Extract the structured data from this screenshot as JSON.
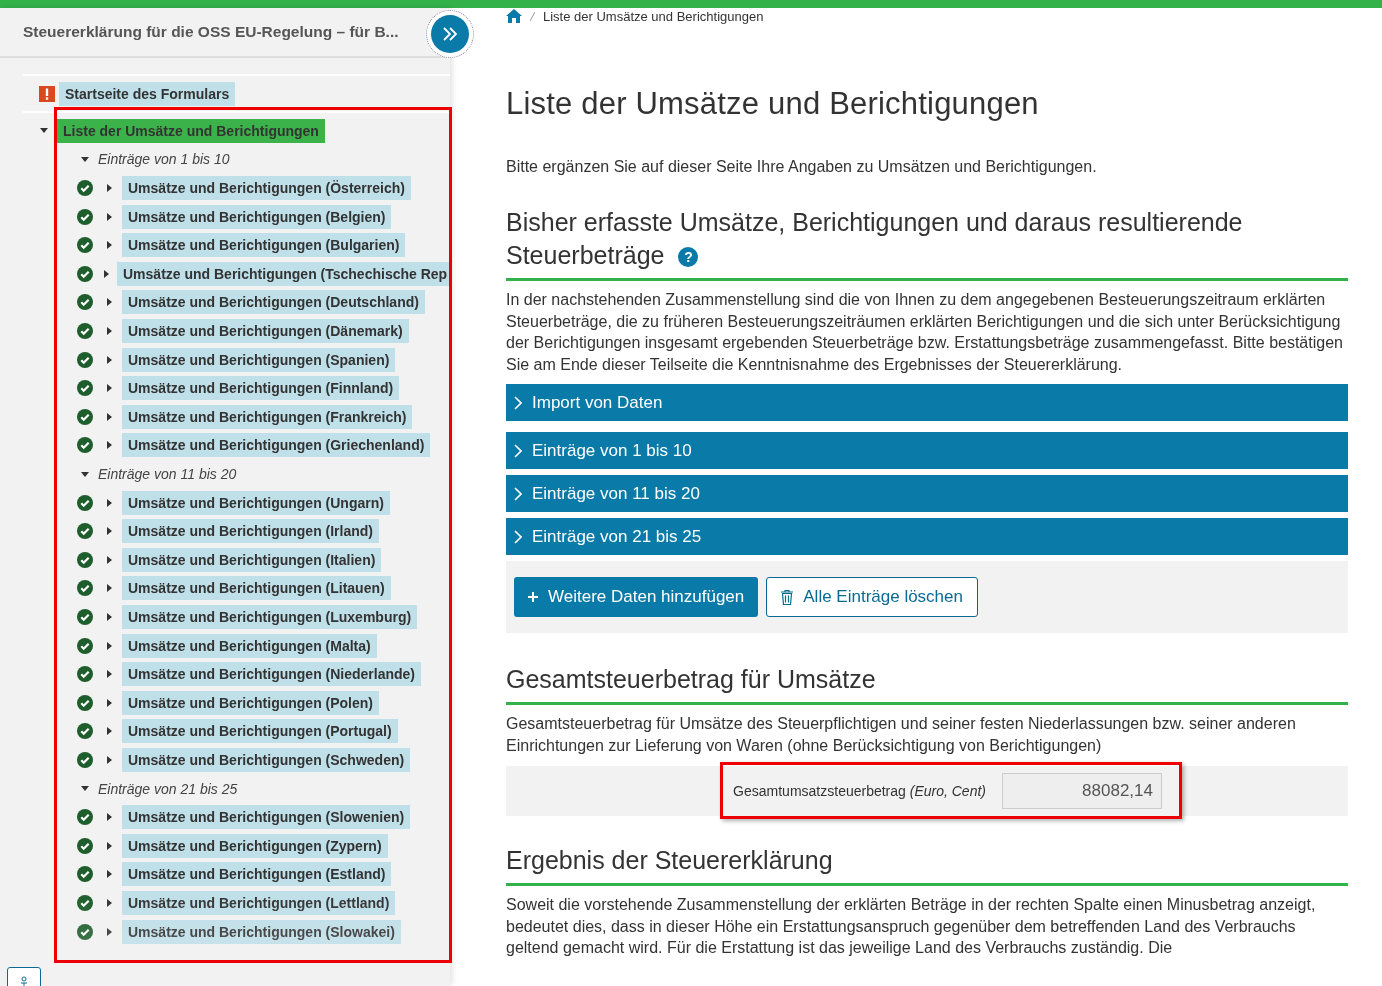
{
  "header": {
    "title": "Steuererklärung für die OSS EU-Regelung – für B..."
  },
  "breadcrumb": {
    "items": [
      "Liste der Umsätze und Berichtigungen"
    ]
  },
  "nav": [
    {
      "label": "Startseite des Formulars",
      "kind": "error",
      "selected": false
    },
    {
      "label": "Liste der Umsätze und Berichtigungen",
      "selected": true,
      "expanded": true,
      "children": [
        {
          "label": "Einträge von 1 bis 10",
          "expanded": true,
          "children": [
            {
              "label": "Umsätze und Berichtigungen (Österreich)",
              "kind": "done",
              "expanded": false
            },
            {
              "label": "Umsätze und Berichtigungen (Belgien)",
              "kind": "done",
              "expanded": false
            },
            {
              "label": "Umsätze und Berichtigungen (Bulgarien)",
              "kind": "done",
              "expanded": false
            },
            {
              "label": "Umsätze und Berichtigungen (Tschechische Rep",
              "kind": "done",
              "expanded": false
            },
            {
              "label": "Umsätze und Berichtigungen (Deutschland)",
              "kind": "done",
              "expanded": false
            },
            {
              "label": "Umsätze und Berichtigungen (Dänemark)",
              "kind": "done",
              "expanded": false
            },
            {
              "label": "Umsätze und Berichtigungen (Spanien)",
              "kind": "done",
              "expanded": false
            },
            {
              "label": "Umsätze und Berichtigungen (Finnland)",
              "kind": "done",
              "expanded": false
            },
            {
              "label": "Umsätze und Berichtigungen (Frankreich)",
              "kind": "done",
              "expanded": false
            },
            {
              "label": "Umsätze und Berichtigungen (Griechenland)",
              "kind": "done",
              "expanded": false
            }
          ]
        },
        {
          "label": "Einträge von 11 bis 20",
          "expanded": true,
          "children": [
            {
              "label": "Umsätze und Berichtigungen (Ungarn)",
              "kind": "done",
              "expanded": false
            },
            {
              "label": "Umsätze und Berichtigungen (Irland)",
              "kind": "done",
              "expanded": false
            },
            {
              "label": "Umsätze und Berichtigungen (Italien)",
              "kind": "done",
              "expanded": false
            },
            {
              "label": "Umsätze und Berichtigungen (Litauen)",
              "kind": "done",
              "expanded": false
            },
            {
              "label": "Umsätze und Berichtigungen (Luxemburg)",
              "kind": "done",
              "expanded": false
            },
            {
              "label": "Umsätze und Berichtigungen (Malta)",
              "kind": "done",
              "expanded": false
            },
            {
              "label": "Umsätze und Berichtigungen (Niederlande)",
              "kind": "done",
              "expanded": false
            },
            {
              "label": "Umsätze und Berichtigungen (Polen)",
              "kind": "done",
              "expanded": false
            },
            {
              "label": "Umsätze und Berichtigungen (Portugal)",
              "kind": "done",
              "expanded": false
            },
            {
              "label": "Umsätze und Berichtigungen (Schweden)",
              "kind": "done",
              "expanded": false
            }
          ]
        },
        {
          "label": "Einträge von 21 bis 25",
          "expanded": true,
          "children": [
            {
              "label": "Umsätze und Berichtigungen (Slowenien)",
              "kind": "done",
              "expanded": false
            },
            {
              "label": "Umsätze und Berichtigungen (Zypern)",
              "kind": "done",
              "expanded": false
            },
            {
              "label": "Umsätze und Berichtigungen (Estland)",
              "kind": "done",
              "expanded": false
            },
            {
              "label": "Umsätze und Berichtigungen (Lettland)",
              "kind": "done",
              "expanded": false
            },
            {
              "label": "Umsätze und Berichtigungen (Slowakei)",
              "kind": "done",
              "expanded": false
            }
          ]
        }
      ]
    }
  ],
  "main": {
    "title": "Liste der Umsätze und Berichtigungen",
    "intro": "Bitte ergänzen Sie auf dieser Seite Ihre Angaben zu Umsätzen und Berichtigungen.",
    "sections": [
      {
        "kind": "list",
        "heading": "Bisher erfasste Umsätze, Berichtigungen und daraus resultierende Steuerbeträge",
        "help": "?",
        "text": "In der nachstehenden Zusammenstellung sind die von Ihnen zu dem angegebenen Besteuerungszeitraum erklärten Steuerbeträge, die zu früheren Besteuerungszeiträumen erklärten Berichtigungen und die sich unter Berücksichtigung der Berichtigungen insgesamt ergebenden Steuerbeträge bzw. Erstattungsbeträge zusammengefasst. Bitte bestätigen Sie am Ende dieser Teilseite die Kenntnisnahme des Ergebnisses der Steuererklärung.",
        "accordions": [
          {
            "label": "Import von Daten",
            "expanded": false
          },
          {
            "label": "Einträge von 1 bis 10",
            "expanded": false
          },
          {
            "label": "Einträge von 11 bis 20",
            "expanded": false
          },
          {
            "label": "Einträge von 21 bis 25",
            "expanded": false
          }
        ],
        "buttons": [
          {
            "label": "Weitere Daten hinzufügen",
            "kind": "primary"
          },
          {
            "label": "Alle Einträge löschen",
            "kind": "secondary"
          }
        ]
      },
      {
        "kind": "field",
        "heading": "Gesamtsteuerbetrag für Umsätze",
        "text": "Gesamtsteuerbetrag für Umsätze des Steuerpflichtigen und seiner festen Niederlassungen bzw. seiner anderen Einrichtungen zur Lieferung von Waren (ohne Berücksichtigung von Berichtigungen)",
        "field": {
          "label": "Gesamtumsatzsteuerbetrag *(Euro, Cent)*",
          "value": "88082,14"
        }
      },
      {
        "kind": "text",
        "heading": "Ergebnis der Steuererklärung",
        "text": "Soweit die vorstehende Zusammenstellung der erklärten Beträge in der rechten Spalte einen Minusbetrag anzeigt, bedeutet dies, dass in dieser Höhe ein Erstattungsanspruch gegenüber dem betreffenden Land des Verbrauchs geltend gemacht wird. Für die Erstattung ist das jeweilige Land des Verbrauchs zuständig. Die"
      }
    ]
  }
}
